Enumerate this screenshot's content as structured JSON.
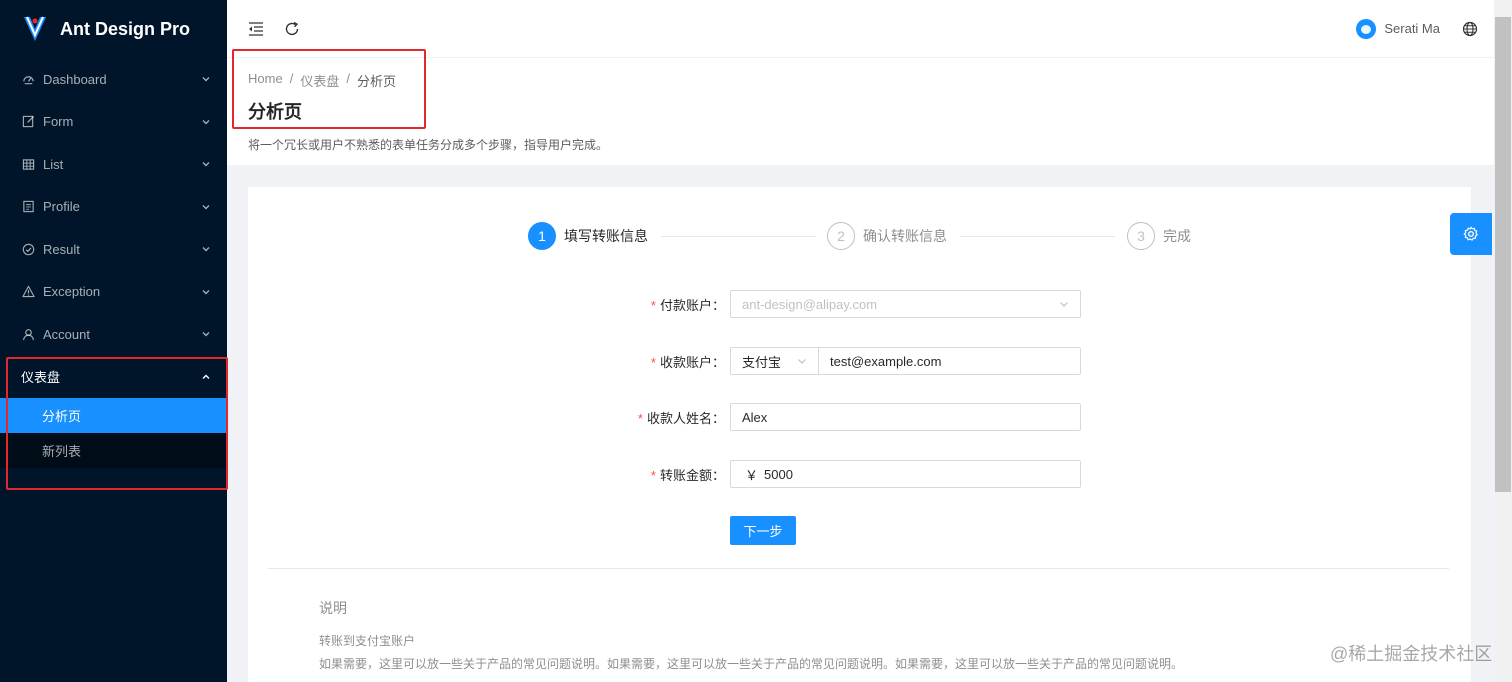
{
  "app": {
    "title": "Ant Design Pro"
  },
  "sidebar": {
    "items": [
      {
        "label": "Dashboard",
        "icon": "dashboard-icon"
      },
      {
        "label": "Form",
        "icon": "form-icon"
      },
      {
        "label": "List",
        "icon": "table-icon"
      },
      {
        "label": "Profile",
        "icon": "profile-icon"
      },
      {
        "label": "Result",
        "icon": "check-circle-icon"
      },
      {
        "label": "Exception",
        "icon": "warning-icon"
      },
      {
        "label": "Account",
        "icon": "user-icon"
      }
    ],
    "open_group": {
      "label": "仪表盘",
      "children": [
        {
          "label": "分析页",
          "active": true
        },
        {
          "label": "新列表",
          "active": false
        }
      ]
    }
  },
  "header": {
    "user_name": "Serati Ma"
  },
  "page": {
    "breadcrumb": [
      "Home",
      "仪表盘",
      "分析页"
    ],
    "title": "分析页",
    "description": "将一个冗长或用户不熟悉的表单任务分成多个步骤，指导用户完成。"
  },
  "steps": [
    {
      "num": "1",
      "label": "填写转账信息",
      "status": "process"
    },
    {
      "num": "2",
      "label": "确认转账信息",
      "status": "wait"
    },
    {
      "num": "3",
      "label": "完成",
      "status": "wait"
    }
  ],
  "form": {
    "pay_account": {
      "label": "付款账户",
      "value": "ant-design@alipay.com"
    },
    "receiver_account": {
      "label": "收款账户",
      "type": "支付宝",
      "value": "test@example.com"
    },
    "receiver_name": {
      "label": "收款人姓名",
      "value": "Alex"
    },
    "amount": {
      "label": "转账金额",
      "prefix": "￥",
      "value": "5000"
    },
    "submit_label": "下一步"
  },
  "description_section": {
    "title": "说明",
    "heading": "转账到支付宝账户",
    "text": "如果需要，这里可以放一些关于产品的常见问题说明。如果需要，这里可以放一些关于产品的常见问题说明。如果需要，这里可以放一些关于产品的常见问题说明。"
  },
  "watermark": "@稀土掘金技术社区",
  "colors": {
    "primary": "#1890ff",
    "sider": "#001529",
    "highlight_box": "#e0282e"
  }
}
